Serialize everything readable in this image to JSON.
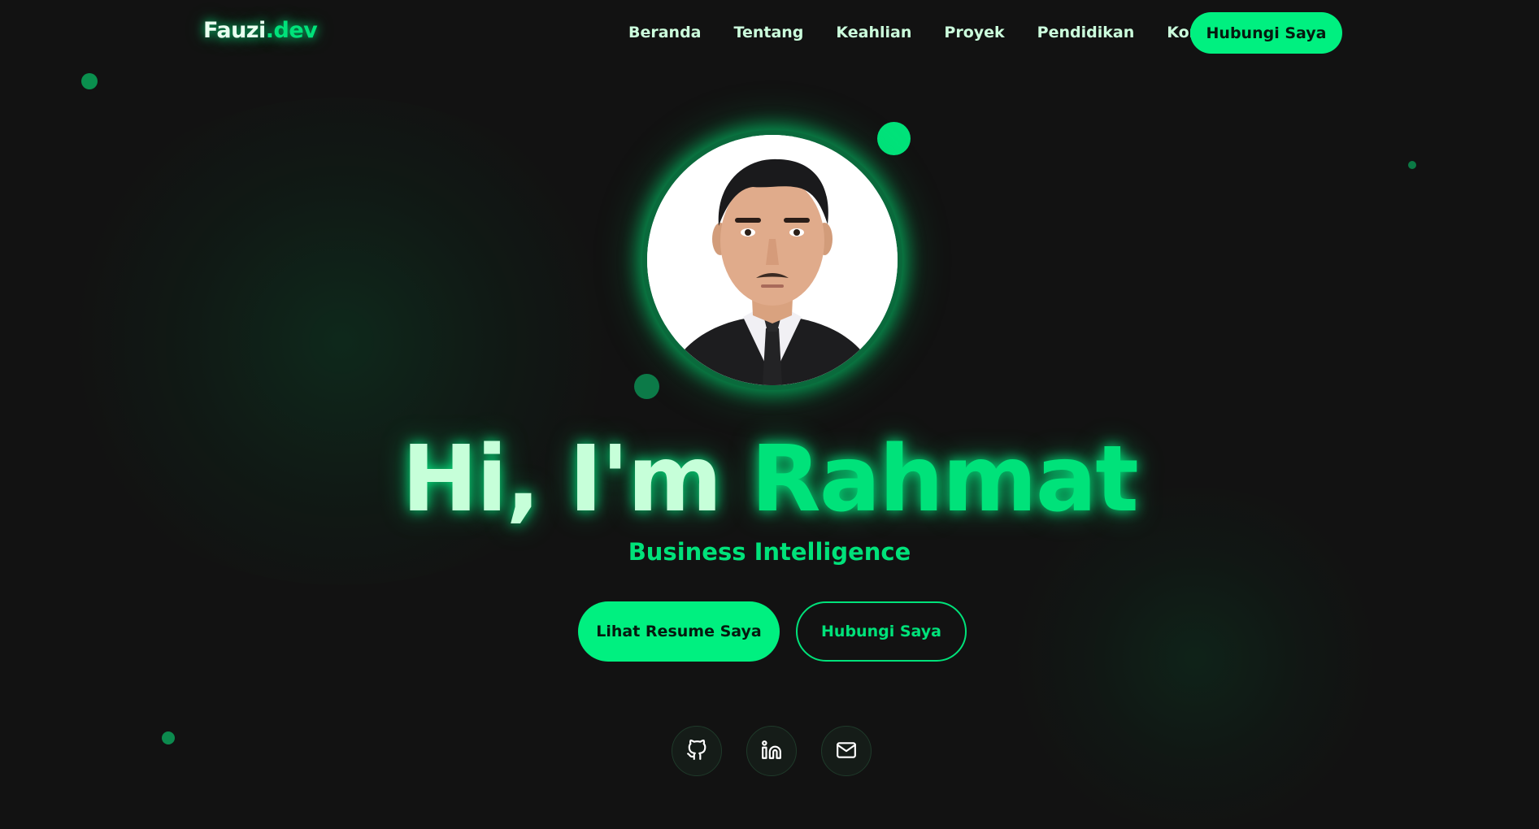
{
  "navbar": {
    "logo_main": "Fauzi",
    "logo_accent": ".dev",
    "links": [
      "Beranda",
      "Tentang",
      "Keahlian",
      "Proyek",
      "Pendidikan",
      "Kontak"
    ],
    "cta_label": "Hubungi Saya"
  },
  "hero": {
    "greeting": "Hi, I'm ",
    "name": "Rahmat",
    "subtitle": "Business Intelligence",
    "primary_button": "Lihat Resume Saya",
    "secondary_button": "Hubungi Saya"
  },
  "social": {
    "icons": [
      "github-icon",
      "linkedin-icon",
      "mail-icon"
    ]
  },
  "colors": {
    "background": "#121212",
    "accent": "#00e27a",
    "accent_bright": "#00f080",
    "text_light": "#ccffdd"
  }
}
